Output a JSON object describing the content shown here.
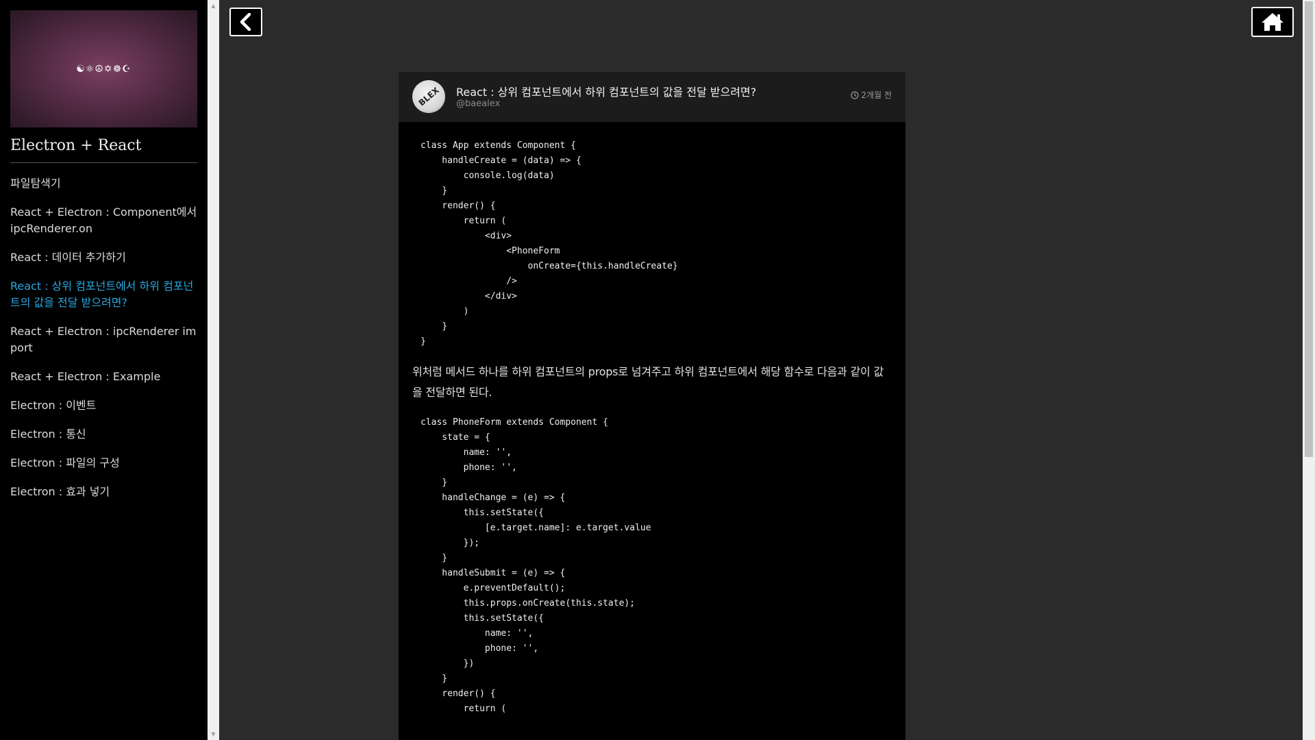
{
  "sidebar": {
    "cover_text": "☯⚛☮✡☸☪",
    "blog_title": "Electron + React",
    "items": [
      {
        "label": "파일탐색기",
        "active": false
      },
      {
        "label": "React + Electron : Component에서 ipcRenderer.on",
        "active": false
      },
      {
        "label": "React : 데이터 추가하기",
        "active": false
      },
      {
        "label": "React : 상위 컴포넌트에서 하위 컴포넌트의 값을 전달 받으려면?",
        "active": true
      },
      {
        "label": "React + Electron : ipcRenderer import",
        "active": false
      },
      {
        "label": "React + Electron : Example",
        "active": false
      },
      {
        "label": "Electron : 이벤트",
        "active": false
      },
      {
        "label": "Electron : 통신",
        "active": false
      },
      {
        "label": "Electron : 파일의 구성",
        "active": false
      },
      {
        "label": "Electron : 효과 넣기",
        "active": false
      }
    ],
    "accent_color": "#29a8e0"
  },
  "toolbar": {
    "back_icon": "chevron-left-icon",
    "home_icon": "home-icon"
  },
  "post": {
    "avatar_text": "BLEX",
    "title": "React : 상위 컴포넌트에서 하위 컴포넌트의 값을 전달 받으려면?",
    "author": "@baealex",
    "time": "2개월 전",
    "code1": "class App extends Component {\n    handleCreate = (data) => {\n        console.log(data)\n    }\n    render() {\n        return (\n            <div>\n                <PhoneForm\n                    onCreate={this.handleCreate}\n                />\n            </div>\n        )\n    }\n}",
    "paragraph": "위처럼 메서드 하나를 하위 컴포넌트의 props로 넘겨주고 하위 컴포넌트에서 해당 함수로 다음과 같이 값을 전달하면 된다.",
    "code2": "class PhoneForm extends Component {\n    state = {\n        name: '',\n        phone: '',\n    }\n    handleChange = (e) => {\n        this.setState({\n            [e.target.name]: e.target.value\n        });\n    }\n    handleSubmit = (e) => {\n        e.preventDefault();\n        this.props.onCreate(this.state);\n        this.setState({\n            name: '',\n            phone: '',\n        })\n    }\n    render() {\n        return ("
  }
}
